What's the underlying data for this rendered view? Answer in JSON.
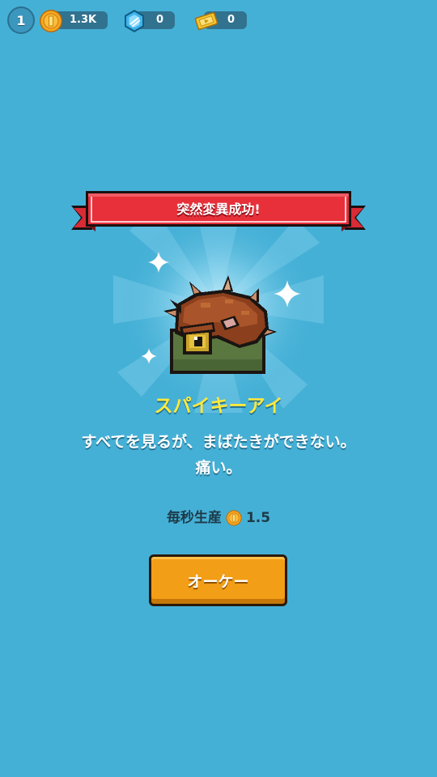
{
  "top_bar": {
    "level": "1",
    "coins": "1.3K",
    "gems": "0",
    "tickets": "0",
    "icons": [
      "coin-icon",
      "gem-icon",
      "ticket-icon"
    ]
  },
  "popup": {
    "banner_title": "突然変異成功!",
    "creature_name": "スパイキーアイ",
    "description": "すべてを見るが、まばたきができない。痛い。",
    "production_label": "毎秒生産",
    "production_value": "1.5",
    "ok_button": "オーケー"
  },
  "colors": {
    "background": "#45b0d6",
    "banner_red": "#e8303a",
    "name_yellow": "#ffe93c",
    "button_orange": "#f29e16"
  }
}
